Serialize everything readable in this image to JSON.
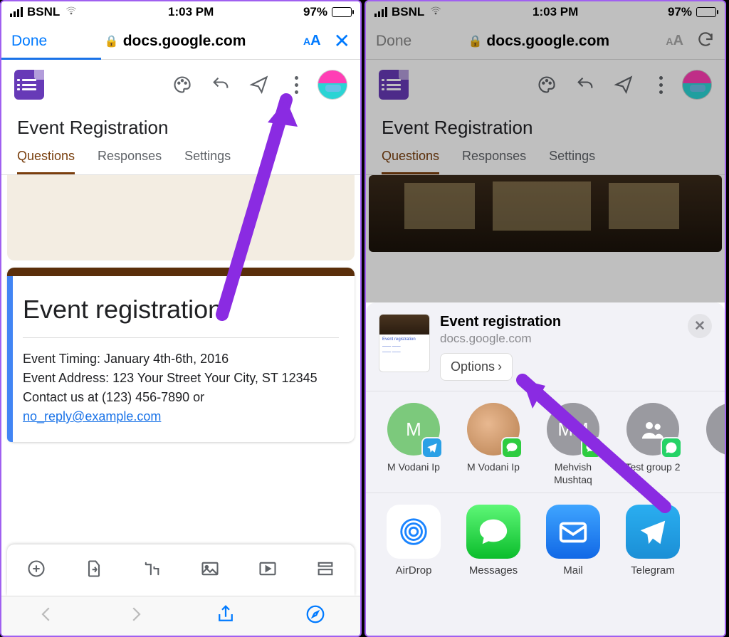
{
  "status": {
    "carrier": "BSNL",
    "time": "1:03 PM",
    "battery": "97%"
  },
  "safari": {
    "done": "Done",
    "url": "docs.google.com",
    "aa": "AA"
  },
  "forms": {
    "toolbar_icons": {
      "palette": "palette-icon",
      "undo": "undo-icon",
      "send": "send-icon",
      "more": "more-icon"
    },
    "title": "Event Registration",
    "tabs": [
      "Questions",
      "Responses",
      "Settings"
    ],
    "card": {
      "heading": "Event registration",
      "line1": "Event Timing: January 4th-6th, 2016",
      "line2": "Event Address: 123 Your Street Your City, ST 12345",
      "line3_a": "Contact us at (123) 456-7890 or ",
      "email": "no_reply@example.com"
    }
  },
  "share": {
    "title": "Event registration",
    "sub": "docs.google.com",
    "options": "Options",
    "contacts": [
      {
        "name": "M Vodani Ip",
        "initial": "M",
        "bubble": "green",
        "badge": "tg"
      },
      {
        "name": "M Vodani Ip",
        "initial": "",
        "bubble": "photo",
        "badge": "im"
      },
      {
        "name": "Mehvish Mushtaq",
        "initial": "MM",
        "bubble": "grey",
        "badge": "im"
      },
      {
        "name": "Test group 2",
        "initial": "",
        "bubble": "grey",
        "badge": "wa",
        "group": true
      }
    ],
    "apps": [
      {
        "name": "AirDrop",
        "cls": "airdrop-ic"
      },
      {
        "name": "Messages",
        "cls": "messages-ic"
      },
      {
        "name": "Mail",
        "cls": "mail-ic"
      },
      {
        "name": "Telegram",
        "cls": "tg-ic"
      }
    ]
  }
}
